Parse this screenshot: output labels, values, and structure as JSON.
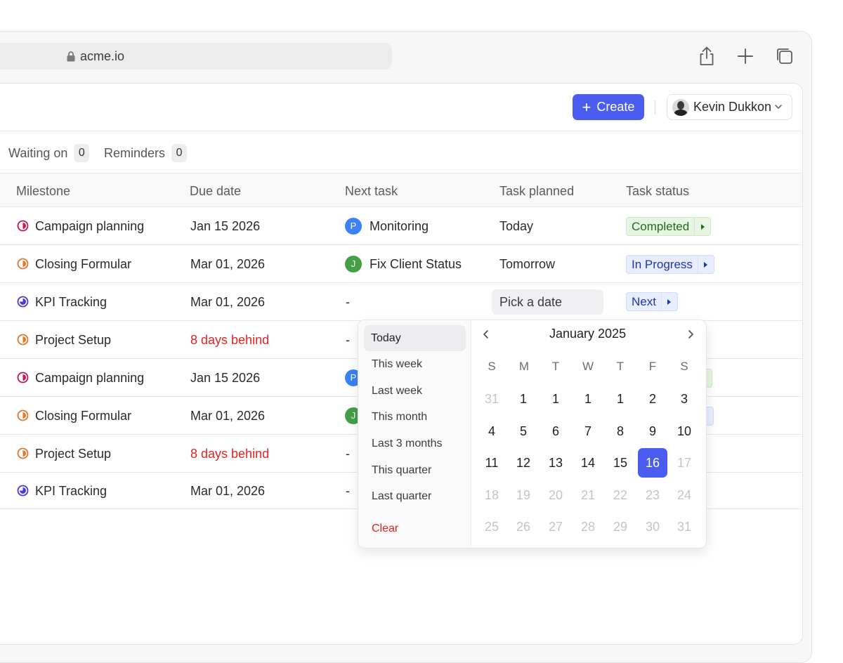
{
  "browser": {
    "url": "acme.io",
    "icons": [
      "share-icon",
      "plus-icon",
      "tabs-icon"
    ]
  },
  "header": {
    "create_label": "Create",
    "user_name": "Kevin Dukkon"
  },
  "filters": [
    {
      "label": "Waiting on",
      "count": "0"
    },
    {
      "label": "Reminders",
      "count": "0"
    }
  ],
  "table": {
    "columns": [
      "Milestone",
      "Due date",
      "Next task",
      "Task planned",
      "Task status"
    ],
    "rows": [
      {
        "milestone": "Campaign planning",
        "due": "Jan 15 2026",
        "task_initial": "P",
        "task": "Monitoring",
        "planned": "Today",
        "status": "Completed"
      },
      {
        "milestone": "Closing Formular",
        "due": "Mar 01, 2026",
        "task_initial": "J",
        "task": "Fix Client Status",
        "planned": "Tomorrow",
        "status": "In Progress"
      },
      {
        "milestone": "KPI Tracking",
        "due": "Mar 01, 2026",
        "task": "-",
        "planned": "Pick a date",
        "status": "Next"
      },
      {
        "milestone": "Project Setup",
        "due": "8 days behind",
        "task": "-"
      },
      {
        "milestone": "Campaign planning",
        "due": "Jan 15 2026",
        "task_initial": "P"
      },
      {
        "milestone": "Closing Formular",
        "due": "Mar 01, 2026",
        "task_initial": "J"
      },
      {
        "milestone": "Project Setup",
        "due": "8 days behind",
        "task": "-"
      },
      {
        "milestone": "KPI Tracking",
        "due": "Mar 01, 2026",
        "task": "-"
      }
    ]
  },
  "datepicker": {
    "presets": [
      "Today",
      "This week",
      "Last week",
      "This month",
      "Last 3 months",
      "This quarter",
      "Last quarter",
      "Clear"
    ],
    "active_preset": "Today",
    "month_label": "January 2025",
    "weekdays": [
      "S",
      "M",
      "T",
      "W",
      "T",
      "F",
      "S"
    ],
    "weeks": [
      [
        "31",
        "1",
        "1",
        "1",
        "1",
        "2",
        "3"
      ],
      [
        "4",
        "5",
        "6",
        "7",
        "8",
        "9",
        "10"
      ],
      [
        "11",
        "12",
        "13",
        "14",
        "15",
        "16",
        "17"
      ],
      [
        "18",
        "19",
        "20",
        "21",
        "22",
        "23",
        "24"
      ],
      [
        "25",
        "26",
        "27",
        "28",
        "29",
        "30",
        "31"
      ]
    ],
    "selected_day": "16"
  },
  "colors": {
    "accent": "#4b5cf0",
    "danger": "#e02424",
    "milestone_pink": "#c2185b",
    "milestone_orange": "#e0782a",
    "milestone_indigo": "#4a3bd1",
    "avatar_blue": "#3b82f6",
    "avatar_green": "#43a047"
  }
}
